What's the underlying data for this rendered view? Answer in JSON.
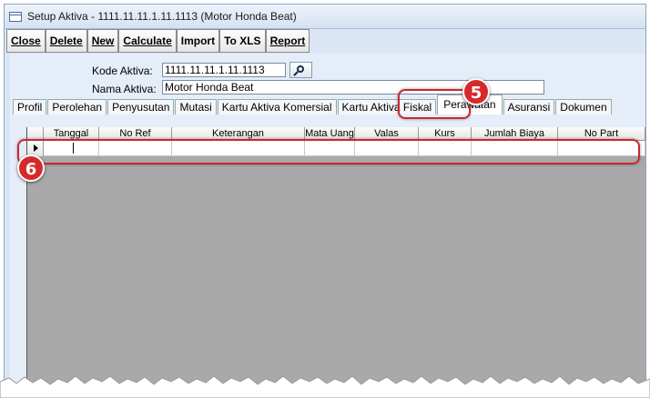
{
  "window": {
    "title": "Setup Aktiva - 1111.11.11.1.11.1113 (Motor Honda Beat)"
  },
  "toolbar": [
    {
      "label": "Close"
    },
    {
      "label": "Delete"
    },
    {
      "label": "New"
    },
    {
      "label": "Calculate"
    },
    {
      "label": "Import"
    },
    {
      "label": "To XLS"
    },
    {
      "label": "Report"
    }
  ],
  "form": {
    "kode_label": "Kode Aktiva:",
    "kode_value": "1111.11.11.1.11.1113",
    "nama_label": "Nama Aktiva:",
    "nama_value": "Motor Honda Beat"
  },
  "tabs": [
    {
      "label": "Profil"
    },
    {
      "label": "Perolehan"
    },
    {
      "label": "Penyusutan"
    },
    {
      "label": "Mutasi"
    },
    {
      "label": "Kartu Aktiva Komersial"
    },
    {
      "label": "Kartu Aktiva Fiskal"
    },
    {
      "label": "Perawatan"
    },
    {
      "label": "Asuransi"
    },
    {
      "label": "Dokumen"
    }
  ],
  "grid": {
    "columns": [
      "Tanggal",
      "No Ref",
      "Keterangan",
      "Mata Uang",
      "Valas",
      "Kurs",
      "Jumlah Biaya",
      "No Part"
    ]
  },
  "callouts": {
    "tab_badge": "5",
    "row_badge": "6"
  },
  "colors": {
    "callout_red": "#d62a2a",
    "toolbar_bg": "#1f3764"
  }
}
